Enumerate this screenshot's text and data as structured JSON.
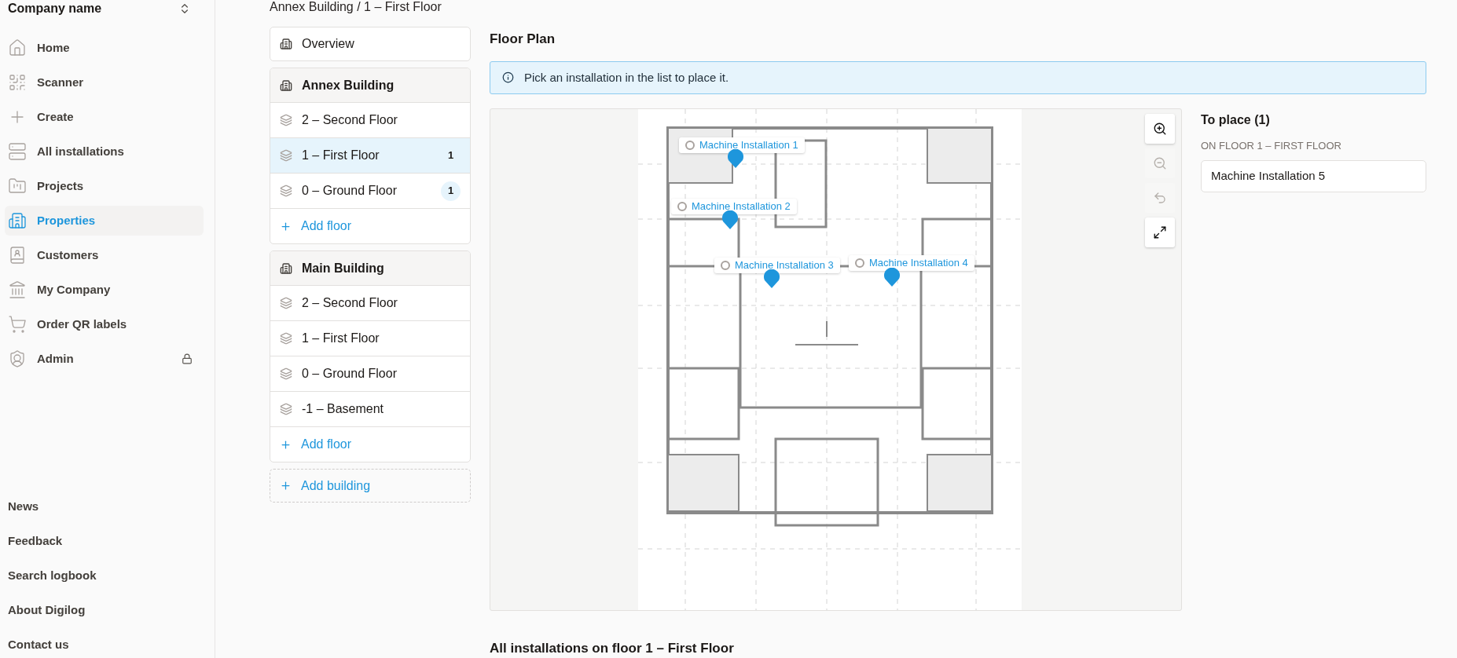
{
  "sidebar": {
    "company": "Company name",
    "nav": [
      {
        "label": "Home",
        "selected": false
      },
      {
        "label": "Scanner",
        "selected": false
      },
      {
        "label": "Create",
        "selected": false
      },
      {
        "label": "All installations",
        "selected": false
      },
      {
        "label": "Projects",
        "selected": false
      },
      {
        "label": "Properties",
        "selected": true
      },
      {
        "label": "Customers",
        "selected": false
      },
      {
        "label": "My Company",
        "selected": false
      },
      {
        "label": "Order QR labels",
        "selected": false
      },
      {
        "label": "Admin",
        "selected": false,
        "locked": true
      }
    ],
    "footer_links": [
      "News",
      "Feedback",
      "Search logbook",
      "About Digilog",
      "Contact us"
    ]
  },
  "breadcrumb": "Annex Building / 1 – First Floor",
  "overview": "Overview",
  "buildings": [
    {
      "name": "Annex Building",
      "add_floor": "Add floor",
      "floors": [
        {
          "label": "2 – Second Floor",
          "selected": false
        },
        {
          "label": "1 – First Floor",
          "selected": true,
          "count": "1"
        },
        {
          "label": "0 – Ground Floor",
          "selected": false,
          "count": "1"
        }
      ]
    },
    {
      "name": "Main Building",
      "add_floor": "Add floor",
      "floors": [
        {
          "label": "2 – Second Floor",
          "selected": false
        },
        {
          "label": "1 – First Floor",
          "selected": false
        },
        {
          "label": "0 – Ground Floor",
          "selected": false
        },
        {
          "label": "-1 – Basement",
          "selected": false
        }
      ]
    }
  ],
  "add_building": "Add building",
  "floor_plan": {
    "title": "Floor Plan",
    "notice": "Pick an installation in the list to place it.",
    "markers": [
      {
        "label": "Machine Installation 1"
      },
      {
        "label": "Machine Installation 2"
      },
      {
        "label": "Machine Installation 3"
      },
      {
        "label": "Machine Installation 4"
      }
    ],
    "tools": [
      {
        "kind": "zoom-in",
        "disabled": false
      },
      {
        "kind": "zoom-out",
        "disabled": true
      },
      {
        "kind": "undo",
        "disabled": true
      },
      {
        "kind": "fullscreen",
        "disabled": false
      }
    ]
  },
  "to_place": {
    "title": "To place (1)",
    "subtitle": "ON FLOOR 1 – FIRST FLOOR",
    "items": [
      "Machine Installation 5"
    ]
  },
  "installations_heading": "All installations on floor 1 – First Floor"
}
